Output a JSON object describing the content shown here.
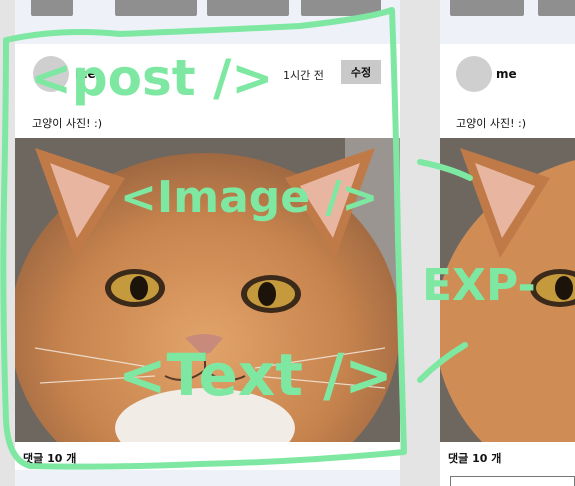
{
  "posts": [
    {
      "username": "me",
      "time_ago": "1시간 전",
      "edit_label": "수정",
      "caption": "고양이 사진! :)",
      "comments": "댓글 10 개"
    },
    {
      "username": "me",
      "caption": "고양이 사진! :)",
      "comments": "댓글 10 개"
    }
  ],
  "annotations": {
    "post": "<post />",
    "image": "<Image />",
    "text": "<Text />",
    "exp": "EXP-"
  },
  "colors": {
    "annotation_stroke": "#7ee8a2",
    "card_bg": "#ffffff",
    "page_bg": "#e4e4e4",
    "edit_button": "#c9c9c9",
    "avatar": "#cfcfcf"
  },
  "icons": [
    "avatar-placeholder-circle",
    "cat-photo"
  ]
}
